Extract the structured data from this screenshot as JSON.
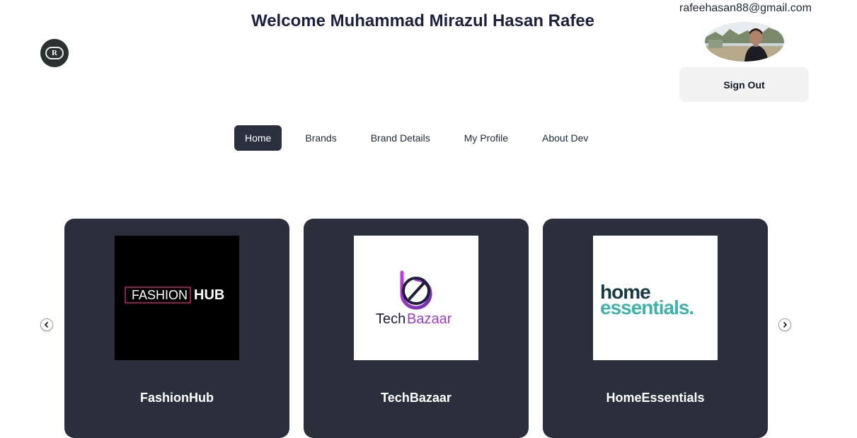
{
  "header": {
    "welcome": "Welcome Muhammad Mirazul Hasan Rafee",
    "logo_letter": "R"
  },
  "user": {
    "email": "rafeehasan88@gmail.com",
    "signout_label": "Sign Out"
  },
  "nav": {
    "items": [
      {
        "label": "Home",
        "active": true
      },
      {
        "label": "Brands"
      },
      {
        "label": "Brand Details"
      },
      {
        "label": "My Profile"
      },
      {
        "label": "About Dev"
      }
    ]
  },
  "brands": [
    {
      "name": "FashionHub",
      "logo_text_a": "FASHION",
      "logo_text_b": "HUB"
    },
    {
      "name": "TechBazaar",
      "logo_text_a": "Tech",
      "logo_text_b": "Bazaar"
    },
    {
      "name": "HomeEssentials",
      "logo_text_a": "home",
      "logo_text_b": "essentials."
    }
  ],
  "icons": {
    "prev": "chevron-left-icon",
    "next": "chevron-right-icon"
  },
  "colors": {
    "card_bg": "#2b2e3b",
    "nav_active": "#2b3040",
    "fashion_accent": "#e5317f",
    "tech_purple": "#9b3ddb",
    "home_teal": "#3db3a9",
    "home_dark": "#173b46"
  }
}
